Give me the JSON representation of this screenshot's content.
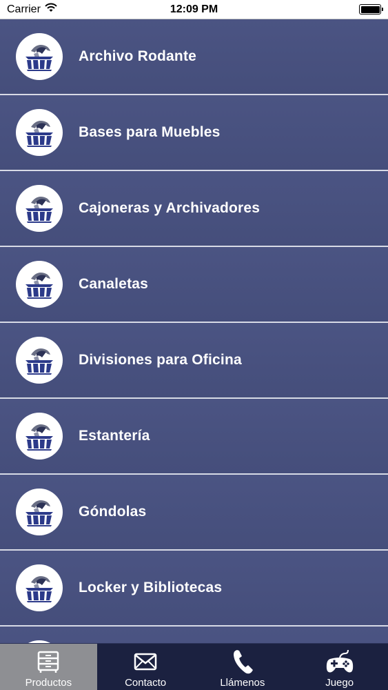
{
  "status_bar": {
    "carrier": "Carrier",
    "time": "12:09 PM",
    "battery_level": 1.0
  },
  "products": [
    {
      "label": "Archivo Rodante",
      "icon": "company-logo-icon"
    },
    {
      "label": "Bases para Muebles",
      "icon": "company-logo-icon"
    },
    {
      "label": "Cajoneras y Archivadores",
      "icon": "company-logo-icon"
    },
    {
      "label": "Canaletas",
      "icon": "company-logo-icon"
    },
    {
      "label": "Divisiones para Oficina",
      "icon": "company-logo-icon"
    },
    {
      "label": "Estantería",
      "icon": "company-logo-icon"
    },
    {
      "label": "Góndolas",
      "icon": "company-logo-icon"
    },
    {
      "label": "Locker y Bibliotecas",
      "icon": "company-logo-icon"
    },
    {
      "label": "",
      "icon": "company-logo-icon"
    }
  ],
  "tab_bar": {
    "active": "productos",
    "tabs": [
      {
        "id": "productos",
        "label": "Productos",
        "icon": "drawer-cabinet-icon"
      },
      {
        "id": "contacto",
        "label": "Contacto",
        "icon": "envelope-icon"
      },
      {
        "id": "llamenos",
        "label": "Llámenos",
        "icon": "phone-icon"
      },
      {
        "id": "juego",
        "label": "Juego",
        "icon": "gamepad-icon"
      }
    ]
  },
  "colors": {
    "list_background": "#454e7a",
    "separator": "#d8dbe6",
    "tab_bar_background": "#1b2140",
    "tab_active_background": "#8e8f93",
    "text": "#ffffff"
  }
}
